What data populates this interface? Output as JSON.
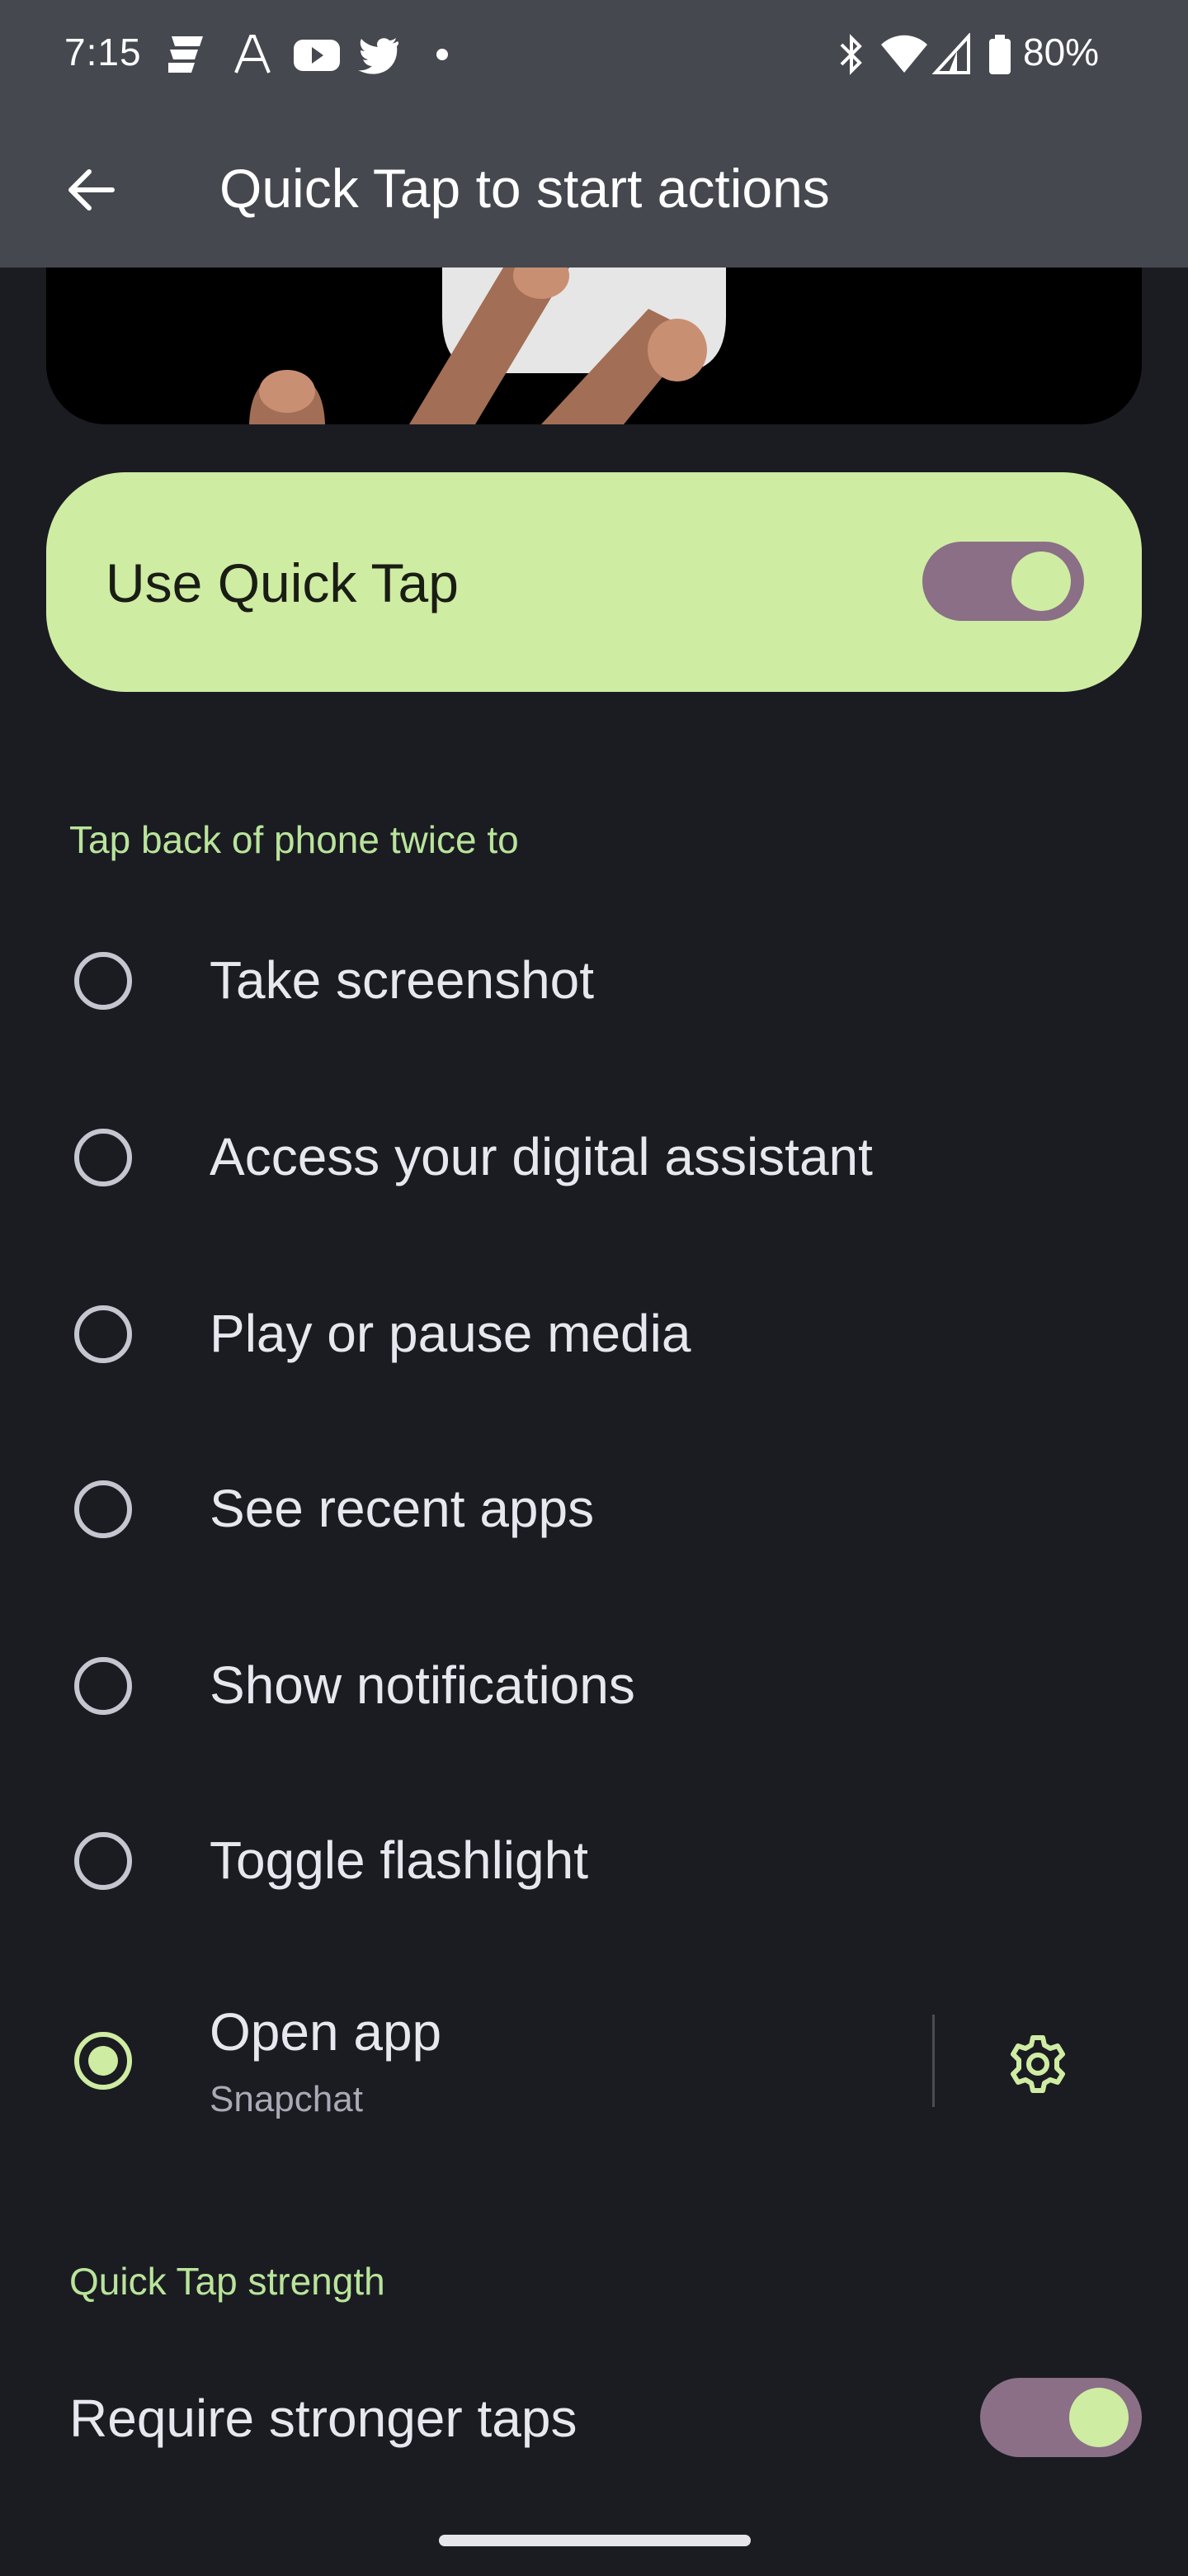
{
  "status_bar": {
    "time": "7:15",
    "notification_icons": [
      "news-icon",
      "font-icon",
      "youtube-icon",
      "twitter-icon",
      "dot-icon"
    ],
    "system_icons": [
      "bluetooth-icon",
      "wifi-icon",
      "cell-signal-icon",
      "battery-icon"
    ],
    "battery": "80%"
  },
  "app_bar": {
    "back_icon": "arrow-back-icon",
    "title": "Quick Tap to start actions"
  },
  "main_toggle": {
    "label": "Use Quick Tap",
    "on": true
  },
  "actions_section": {
    "header": "Tap back of phone twice to",
    "options": [
      {
        "label": "Take screenshot",
        "selected": false
      },
      {
        "label": "Access your digital assistant",
        "selected": false
      },
      {
        "label": "Play or pause media",
        "selected": false
      },
      {
        "label": "See recent apps",
        "selected": false
      },
      {
        "label": "Show notifications",
        "selected": false
      },
      {
        "label": "Toggle flashlight",
        "selected": false
      },
      {
        "label": "Open app",
        "sublabel": "Snapchat",
        "selected": true,
        "settings_icon": "gear-icon"
      }
    ]
  },
  "strength_section": {
    "header": "Quick Tap strength",
    "label": "Require stronger taps",
    "on": true
  },
  "colors": {
    "background": "#1b1c22",
    "app_bar": "#45484f",
    "accent_green": "#cfeca3",
    "section_header": "#b9e49b",
    "switch_track": "#8a6f86"
  }
}
